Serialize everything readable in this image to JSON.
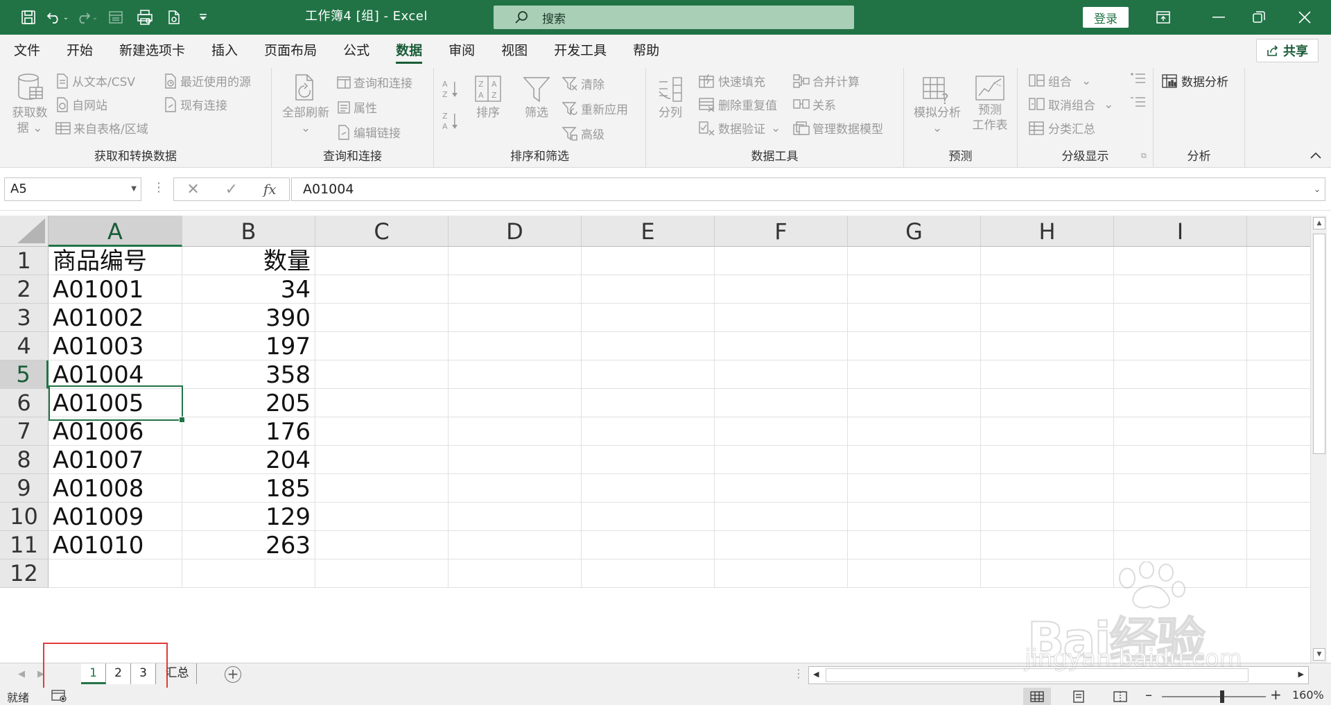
{
  "window": {
    "title": "工作簿4  [组]  -  Excel",
    "search_placeholder": "搜索",
    "login_label": "登录",
    "share_label": "共享"
  },
  "menu": {
    "tabs": [
      "文件",
      "开始",
      "新建选项卡",
      "插入",
      "页面布局",
      "公式",
      "数据",
      "审阅",
      "视图",
      "开发工具",
      "帮助"
    ],
    "active": "数据"
  },
  "ribbon": {
    "get_data": {
      "big": "获取数据",
      "big_l1": "获取数",
      "big_l2": "据",
      "from_text": "从文本/CSV",
      "from_web": "自网站",
      "from_table": "来自表格/区域",
      "recent": "最近使用的源",
      "existing": "现有连接",
      "label": "获取和转换数据"
    },
    "queries": {
      "refresh_l1": "全部刷新",
      "queries_connections": "查询和连接",
      "properties": "属性",
      "edit_links": "编辑链接",
      "label": "查询和连接"
    },
    "sort_filter": {
      "sort": "排序",
      "filter": "筛选",
      "clear": "清除",
      "reapply": "重新应用",
      "advanced": "高级",
      "label": "排序和筛选"
    },
    "data_tools": {
      "split": "分列",
      "flash_fill": "快速填充",
      "remove_dup": "删除重复值",
      "validation": "数据验证",
      "consolidate": "合并计算",
      "relationships": "关系",
      "data_model": "管理数据模型",
      "label": "数据工具"
    },
    "forecast": {
      "what_if": "模拟分析",
      "sheet_l1": "预测",
      "sheet_l2": "工作表",
      "label": "预测"
    },
    "outline": {
      "group": "组合",
      "ungroup": "取消组合",
      "subtotal": "分类汇总",
      "label": "分级显示"
    },
    "analysis": {
      "data_analysis": "数据分析",
      "label": "分析"
    }
  },
  "formula_bar": {
    "name_box": "A5",
    "content": "A01004"
  },
  "grid": {
    "columns": [
      "A",
      "B",
      "C",
      "D",
      "E",
      "F",
      "G",
      "H",
      "I"
    ],
    "selected_column": "A",
    "selected_row": "5",
    "rows": [
      {
        "n": "1",
        "a": "商品编号",
        "b": "数量"
      },
      {
        "n": "2",
        "a": "A01001",
        "b": "34"
      },
      {
        "n": "3",
        "a": "A01002",
        "b": "390"
      },
      {
        "n": "4",
        "a": "A01003",
        "b": "197"
      },
      {
        "n": "5",
        "a": "A01004",
        "b": "358"
      },
      {
        "n": "6",
        "a": "A01005",
        "b": "205"
      },
      {
        "n": "7",
        "a": "A01006",
        "b": "176"
      },
      {
        "n": "8",
        "a": "A01007",
        "b": "204"
      },
      {
        "n": "9",
        "a": "A01008",
        "b": "185"
      },
      {
        "n": "10",
        "a": "A01009",
        "b": "129"
      },
      {
        "n": "11",
        "a": "A01010",
        "b": "263"
      },
      {
        "n": "12",
        "a": "",
        "b": ""
      }
    ]
  },
  "sheets": {
    "tabs": [
      "1",
      "2",
      "3",
      "汇总"
    ],
    "active": "1"
  },
  "status": {
    "ready": "就绪",
    "zoom": "160%"
  },
  "watermark": {
    "text": "Bai经验",
    "url": "jingyan.baidu.com"
  },
  "colors": {
    "accent": "#217346",
    "accent_dark": "#185c37",
    "highlight_box": "#e23a3a"
  }
}
